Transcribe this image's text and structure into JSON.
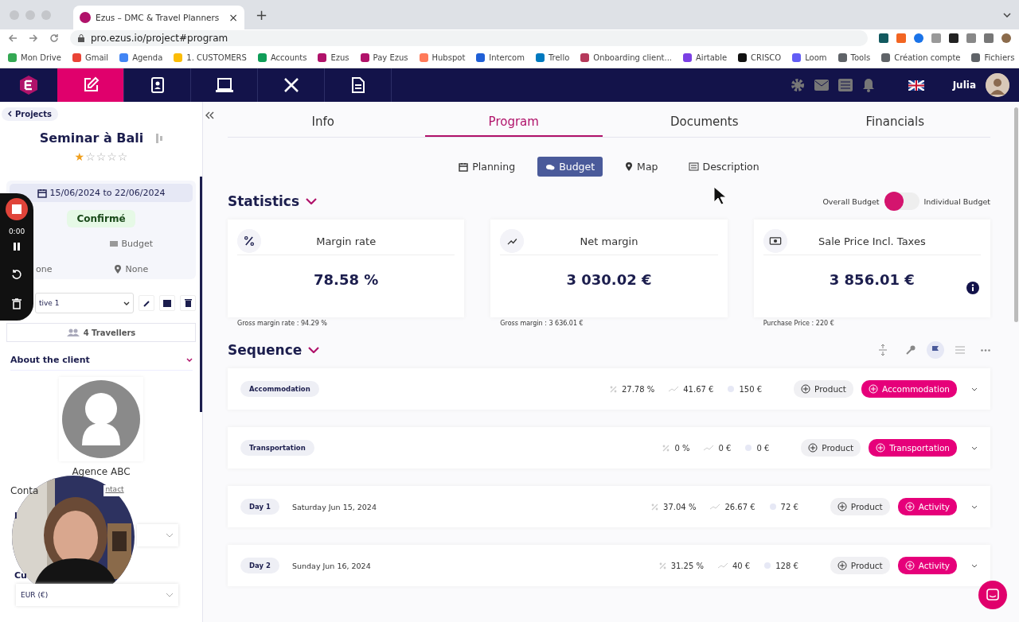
{
  "browser": {
    "tab_title": "Ezus – DMC & Travel Planners",
    "tab_close": "×",
    "new_tab": "+",
    "url": "pro.ezus.io/project#program",
    "bookmarks": [
      {
        "label": "Mon Drive",
        "color": "#34a853"
      },
      {
        "label": "Gmail",
        "color": "#ea4335"
      },
      {
        "label": "Agenda",
        "color": "#4285f4"
      },
      {
        "label": "1. CUSTOMERS",
        "color": "#fbbc05"
      },
      {
        "label": "Accounts",
        "color": "#0f9d58"
      },
      {
        "label": "Ezus",
        "color": "#b0126a"
      },
      {
        "label": "Pay Ezus",
        "color": "#b0126a"
      },
      {
        "label": "Hubspot",
        "color": "#ff7a59"
      },
      {
        "label": "Intercom",
        "color": "#1f5fd6"
      },
      {
        "label": "Trello",
        "color": "#0079bf"
      },
      {
        "label": "Onboarding client...",
        "color": "#b5395b"
      },
      {
        "label": "Airtable",
        "color": "#7b3fe4"
      },
      {
        "label": "CRISCO",
        "color": "#111111"
      },
      {
        "label": "Loom",
        "color": "#625df5"
      },
      {
        "label": "Tools",
        "color": "#5f6368"
      },
      {
        "label": "Création compte",
        "color": "#5f6368"
      },
      {
        "label": "Fichiers",
        "color": "#5f6368"
      }
    ]
  },
  "topnav": {
    "items": [
      {
        "kind": "edit",
        "selected": true
      },
      {
        "kind": "contacts",
        "selected": false
      },
      {
        "kind": "laptop",
        "selected": false
      },
      {
        "kind": "tools",
        "selected": false
      },
      {
        "kind": "document",
        "selected": false
      }
    ],
    "user": "Julia"
  },
  "sidebar": {
    "back": "Projects",
    "title": "Seminar à Bali",
    "stars": 1,
    "dates": "15/06/2024 to 22/06/2024",
    "status": "Confirmé",
    "budget": "Budget",
    "field_left": "one",
    "field_right": "None",
    "option": "tive 1",
    "travellers": "4 Travellers",
    "about": "About the client",
    "client": "Agence ABC",
    "contact_left": "Conta",
    "contact_link": "ntact",
    "label_cut": "l",
    "currency_label": "Cu",
    "currency": "EUR (€)"
  },
  "recorder": {
    "time": "0:00"
  },
  "main": {
    "tabs": [
      {
        "label": "Info",
        "selected": false
      },
      {
        "label": "Program",
        "selected": true
      },
      {
        "label": "Documents",
        "selected": false
      },
      {
        "label": "Financials",
        "selected": false
      }
    ],
    "subtabs": [
      {
        "kind": "calendar",
        "label": "Planning",
        "selected": false
      },
      {
        "kind": "coins",
        "label": "Budget",
        "selected": true
      },
      {
        "kind": "pin",
        "label": "Map",
        "selected": false
      },
      {
        "kind": "list",
        "label": "Description",
        "selected": false
      }
    ],
    "statistics": "Statistics",
    "toggle": {
      "left": "Overall Budget",
      "right": "Individual Budget",
      "on": false
    },
    "cards": [
      {
        "kind": "percent",
        "title": "Margin rate",
        "value": "78.58 %",
        "note": "Gross margin rate : 94.29 %",
        "info": false
      },
      {
        "kind": "trend",
        "title": "Net margin",
        "value": "3 030.02 €",
        "note": "Gross margin : 3 636.01 €",
        "info": false
      },
      {
        "kind": "money",
        "title": "Sale Price Incl. Taxes",
        "value": "3 856.01 €",
        "note": "Purchase Price : 220 €",
        "info": true
      }
    ],
    "sequence": "Sequence",
    "rows": [
      {
        "tag": "Accommodation",
        "rate": "27.78 %",
        "margin": "41.67 €",
        "price": "150 €",
        "product": "Product",
        "action": "Accommodation"
      },
      {
        "tag": "Transportation",
        "rate": "0 %",
        "margin": "0 €",
        "price": "0 €",
        "product": "Product",
        "action": "Transportation"
      },
      {
        "tag": "Day 1",
        "date": "Saturday Jun 15, 2024",
        "rate": "37.04 %",
        "margin": "26.67 €",
        "price": "72 €",
        "product": "Product",
        "action": "Activity"
      },
      {
        "tag": "Day 2",
        "date": "Sunday Jun 16, 2024",
        "rate": "31.25 %",
        "margin": "40 €",
        "price": "128 €",
        "product": "Product",
        "action": "Activity"
      }
    ]
  }
}
